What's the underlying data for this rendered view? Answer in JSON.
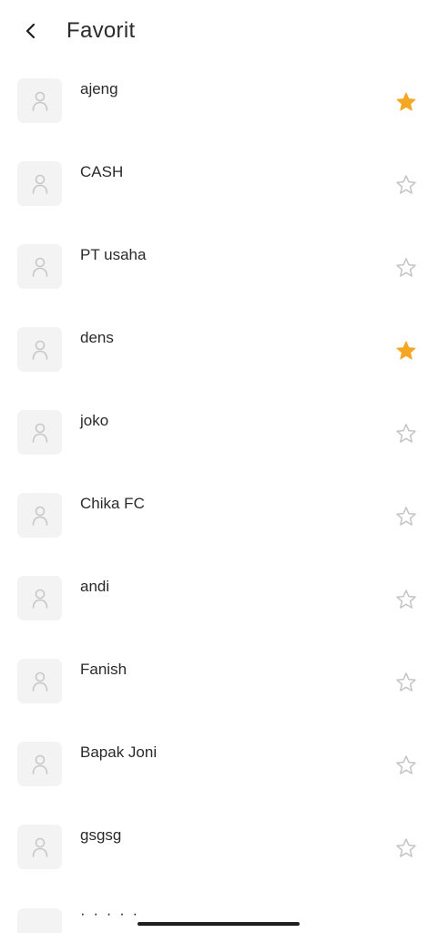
{
  "header": {
    "title": "Favorit",
    "back_icon": "chevron-left-icon"
  },
  "colors": {
    "star_active": "#f5a623",
    "star_inactive": "#c4c4c4",
    "avatar_bg": "#f3f3f3",
    "avatar_icon": "#c8c8c8"
  },
  "favorites": [
    {
      "name": "ajeng",
      "favorite": true
    },
    {
      "name": "CASH",
      "favorite": false
    },
    {
      "name": "PT usaha",
      "favorite": false
    },
    {
      "name": "dens",
      "favorite": true
    },
    {
      "name": "joko",
      "favorite": false
    },
    {
      "name": "Chika FC",
      "favorite": false
    },
    {
      "name": "andi",
      "favorite": false
    },
    {
      "name": "Fanish",
      "favorite": false
    },
    {
      "name": "Bapak Joni",
      "favorite": false
    },
    {
      "name": "gsgsg",
      "favorite": false
    }
  ],
  "partial_row": {
    "name": "· · · · ·"
  }
}
